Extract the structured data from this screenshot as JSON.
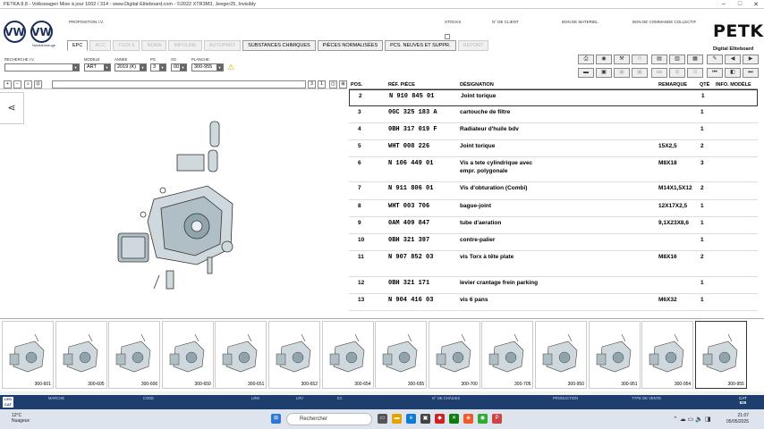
{
  "window": {
    "title": "PETKA 8.8 - Volkswagen Mise à jour 1602 / 314 - www.Digital-Eliteboard.com - ©2022 XTR3M3, Jeeger25, Invisibly"
  },
  "header": {
    "brand_small": "Nutzfahrzeuge",
    "proposition": "PROPOSITION I.V.",
    "labels": {
      "stocks": "STOCKS",
      "client": "N° DE CLIENT",
      "materiel": "BON DE MATERIEL",
      "commande": "BON DE COMMANDE COLLECTIF"
    },
    "product": "PETKA",
    "product_sub": "Digital Eliteboard"
  },
  "tabs": [
    {
      "label": "EPC",
      "state": "active"
    },
    {
      "label": "ACC",
      "state": "disabled"
    },
    {
      "label": "TOOLS",
      "state": "disabled"
    },
    {
      "label": "NORA",
      "state": "disabled"
    },
    {
      "label": "INFOLINE",
      "state": "disabled"
    },
    {
      "label": "AUTOPART",
      "state": "disabled"
    },
    {
      "label": "SUBSTANCES CHIMIQUES",
      "state": "enabled"
    },
    {
      "label": "PIÈCES NORMALISÉES",
      "state": "enabled"
    },
    {
      "label": "PCS. NEUVES ET SUPPR.",
      "state": "enabled"
    },
    {
      "label": "REPORT",
      "state": "disabled"
    }
  ],
  "filters": {
    "recherche_label": "RECHERCHE I.V.",
    "recherche_value": "",
    "modele_label": "MODELE",
    "modele_value": "ART",
    "annee_label": "ANNEE",
    "annee_value": "2019 (K)",
    "pg_label": "PG",
    "pg_value": "3",
    "sg_label": "SG",
    "sg_value": "00",
    "planche_label": "PLANCHE",
    "planche_value": "300-955"
  },
  "zoom": {
    "page_left": "3",
    "page_right": "1"
  },
  "table": {
    "headers": {
      "pos": "POS.",
      "ref": "RÉF. PIÈCE",
      "designation": "DÉSIGNATION",
      "remarque": "REMARQUE",
      "qty": "QTÉ",
      "info": "INFO. MODÈLE"
    },
    "rows": [
      {
        "pos": "2",
        "ref": "N    910 845 01",
        "designation": "Joint torique",
        "designation2": "",
        "remarque": "",
        "qty": "1"
      },
      {
        "pos": "3",
        "ref": "0GC 325 183 A",
        "designation": "cartouche de filtre",
        "designation2": "",
        "remarque": "",
        "qty": "1"
      },
      {
        "pos": "4",
        "ref": "0BH 317 019 F",
        "designation": "Radiateur d'huile bdv",
        "designation2": "",
        "remarque": "",
        "qty": "1"
      },
      {
        "pos": "5",
        "ref": "WHT 008 226",
        "designation": "Joint torique",
        "designation2": "",
        "remarque": "15X2,5",
        "qty": "2"
      },
      {
        "pos": "6",
        "ref": "N    106 449 01",
        "designation": "Vis a tete cylindrique avec",
        "designation2": "empr. polygonale",
        "remarque": "M8X18",
        "qty": "3"
      },
      {
        "pos": "7",
        "ref": "N    911 806 01",
        "designation": "Vis d'obturation (Combi)",
        "designation2": "",
        "remarque": "M14X1,5X12",
        "qty": "2"
      },
      {
        "pos": "8",
        "ref": "WHT 003 706",
        "designation": "bague-joint",
        "designation2": "",
        "remarque": "12X17X2,5",
        "qty": "1"
      },
      {
        "pos": "9",
        "ref": "0AM 409 847",
        "designation": "tube d'aeration",
        "designation2": "",
        "remarque": "9,1X23X8,6",
        "qty": "1"
      },
      {
        "pos": "10",
        "ref": "0BH 321 397",
        "designation": "contre-palier",
        "designation2": "",
        "remarque": "",
        "qty": "1"
      },
      {
        "pos": "11",
        "ref": "N    907 852 03",
        "designation": "vis Torx à tête plate",
        "designation2": "",
        "remarque": "M8X16",
        "qty": "2"
      },
      {
        "pos": "12",
        "ref": "0BH 321 171",
        "designation": "levier crantage frein parking",
        "designation2": "",
        "remarque": "",
        "qty": "1"
      },
      {
        "pos": "13",
        "ref": "N    904 416 03",
        "designation": "vis 6 pans",
        "designation2": "",
        "remarque": "M6X32",
        "qty": "1"
      }
    ]
  },
  "thumbnails": [
    "300-601",
    "300-605",
    "300-606",
    "300-650",
    "300-651",
    "300-652",
    "300-654",
    "300-655",
    "300-700",
    "300-705",
    "300-950",
    "300-951",
    "300-954",
    "300-955"
  ],
  "active_thumbnail": "300-955",
  "statusbar": {
    "logo": "LEO CAT",
    "labels": {
      "marche": "MARCHE",
      "code": "CODE",
      "lrm": "LRM",
      "lrv": "LRV",
      "ec": "EC",
      "chassis": "N° DE CHÂSSIS",
      "production": "PRODUCTION",
      "vente": "TYPE DE VENTE"
    },
    "cat_label": "CAT",
    "cat_value": "828"
  },
  "taskbar": {
    "temperature": "12°C",
    "weather": "Nuageux",
    "search_placeholder": "Rechercher",
    "time": "21:07",
    "date": "05/05/2025"
  }
}
